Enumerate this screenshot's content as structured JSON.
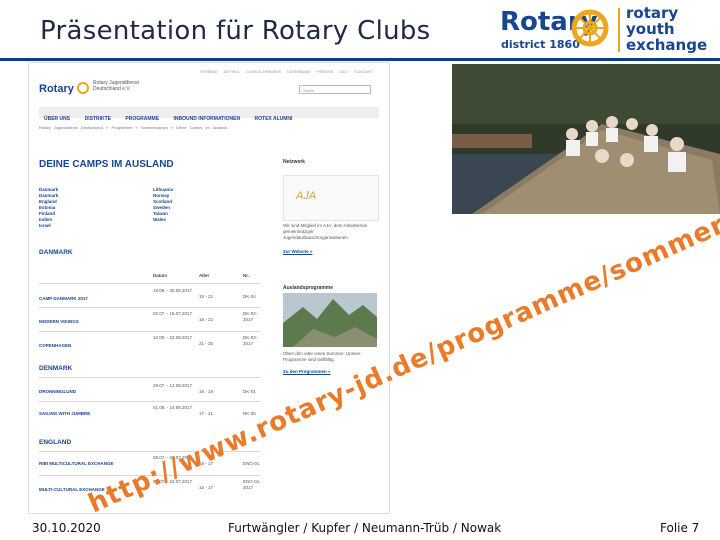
{
  "slide": {
    "title": "Präsentation für Rotary Clubs",
    "footer_date": "30.10.2020",
    "footer_authors": "Furtwängler / Kupfer / Neumann-Trüb / Nowak",
    "footer_page": "Folie 7",
    "url_watermark": "http://www.rotary-jd.de/programme/sommercamps/deine-camps-im-ausland"
  },
  "logo": {
    "rotary": "Rotary",
    "district": "district 1860",
    "rye_line1": "rotary",
    "rye_line2": "youth",
    "rye_line3": "exchange"
  },
  "website": {
    "top_links": "TERMINE ARTIKEL DANKSCHREIBEN DATENBANK PRESSE 2017 KONTAKT",
    "logo_word": "Rotary",
    "logo_sub": "Rotary Jugenddienst Deutschland e.V.",
    "search_placeholder": "Suche",
    "nav": [
      "ÜBER UNS",
      "DISTRIKTE",
      "PROGRAMME",
      "INBOUND INFORMATIONEN",
      "ROTEX ALUMNI"
    ],
    "breadcrumb": "Rotary Jugenddienst Deutschland  »  Programme  »  Sommercamps  »  Deine Camps im Ausland",
    "heading": "DEINE CAMPS IM AUSLAND",
    "countries_left": [
      "Danmark",
      "Danmark",
      "England",
      "Estonia",
      "Finland",
      "Indien",
      "Israel"
    ],
    "countries_right": [
      "Lithuania",
      "Norway",
      "Scotland",
      "Sweden",
      "Taiwan",
      "Wales"
    ],
    "table_head": {
      "datum": "Datum",
      "alter": "Alter",
      "nr": "Nr."
    },
    "sections": [
      {
        "title": "DANMARK",
        "rows": [
          {
            "name": "CAMP DANMARK 2017",
            "datum": "19.08. - 30.08.2017",
            "alter": "18 - 21",
            "nr": "DK-04"
          },
          {
            "name": "MODERN VIKINGS",
            "datum": "02.07. - 16.07.2017",
            "alter": "18 - 22",
            "nr": "DK-02-2017"
          },
          {
            "name": "COPENHAGEN",
            "datum": "12.08. - 23.08.2017",
            "alter": "21 - 25",
            "nr": "DK-03-2017"
          }
        ]
      },
      {
        "title": "DENMARK",
        "rows": [
          {
            "name": "DRONNINGLUND",
            "datum": "29.07. - 12.08.2017",
            "alter": "16 - 19",
            "nr": "DK-01"
          },
          {
            "name": "SAILING WITH JUMBRE",
            "datum": "01.08. - 14.08.2017",
            "alter": "17 - 21",
            "nr": "DK-05"
          }
        ]
      },
      {
        "title": "ENGLAND",
        "rows": [
          {
            "name": "RIBI MULTICULTURAL EXCHANGE",
            "datum": "08.07. - 22.07.2017",
            "alter": "15 - 17",
            "nr": "ENG-01"
          },
          {
            "name": "MULTI-CULTURAL EXCHANGE",
            "datum": "08.07. - 22.07.2017",
            "alter": "15 - 17",
            "nr": "ENG-01-2017"
          }
        ]
      }
    ],
    "aside": {
      "netzwerk": "Netzwerk",
      "aja": "AJA",
      "aja_text": "Wir sind Mitglied im AJA, dem Arbeitskreis gemeinnütziger Jugendaustauschorganisationen.",
      "aja_link": "Zur Website »",
      "ausland": "Auslandsprogramme",
      "ausland_text": "Oben drin oder einen Sommer: Unsere Programme sind vielfältig.",
      "ausland_link": "Zu den Programmen »"
    }
  },
  "colors": {
    "rotary_blue": "#17458f",
    "rotary_gold": "#f0a51f",
    "url_orange": "#ea7b2a"
  }
}
